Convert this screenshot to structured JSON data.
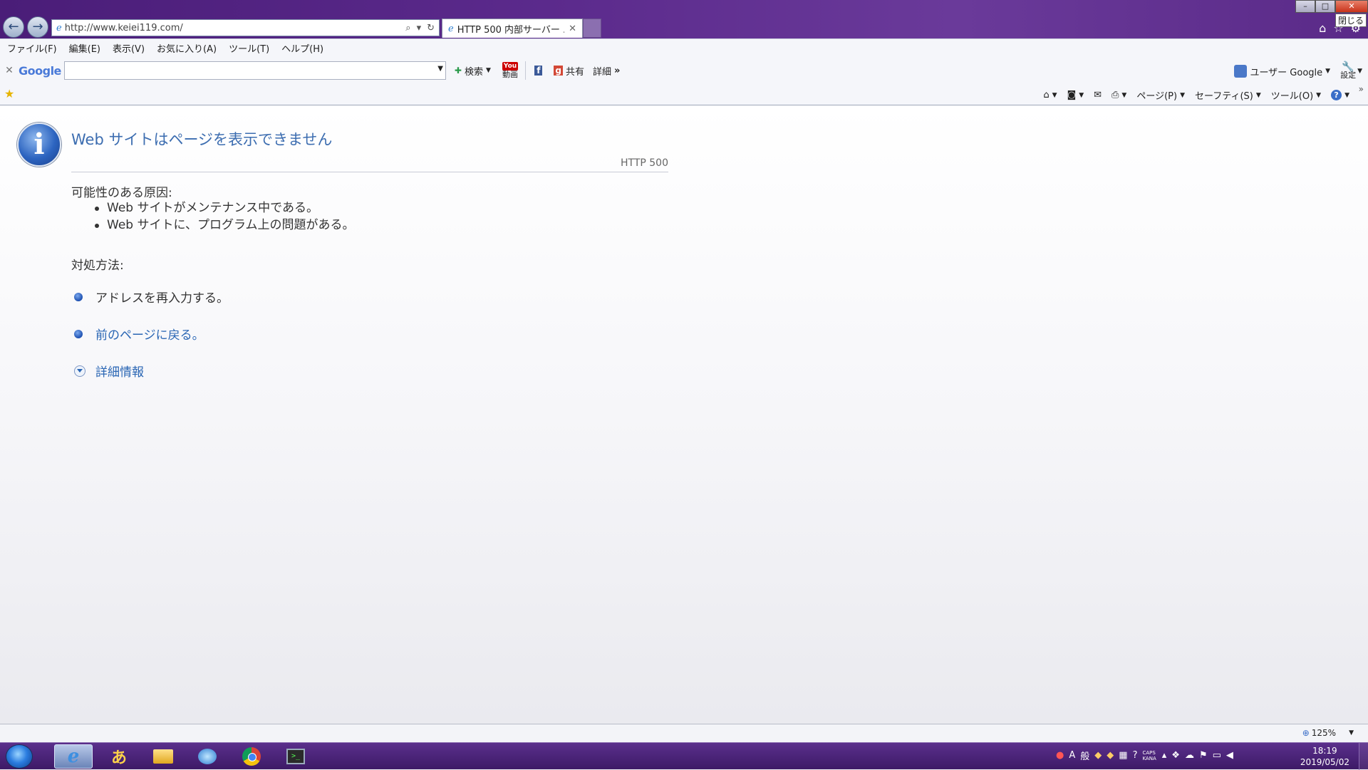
{
  "browser": {
    "address_url": "http://www.keiei119.com/",
    "tab_title": "HTTP 500 内部サーバー ...",
    "close_tooltip": "閉じる"
  },
  "menu": {
    "items": [
      "ファイル(F)",
      "編集(E)",
      "表示(V)",
      "お気に入り(A)",
      "ツール(T)",
      "ヘルプ(H)"
    ]
  },
  "google_toolbar": {
    "logo": "Google",
    "search_placeholder": "",
    "search_label": "検索",
    "youtube_logo": "You",
    "video_label": "動画",
    "share_label": "共有",
    "details_label": "詳細",
    "more": "»",
    "user_label": "ユーザー Google",
    "settings_label": "設定"
  },
  "command_bar": {
    "page_label": "ページ(P)",
    "safety_label": "セーフティ(S)",
    "tools_label": "ツール(O)"
  },
  "error_page": {
    "title": "Web サイトはページを表示できません",
    "code": "HTTP 500",
    "causes_heading": "可能性のある原因:",
    "causes": [
      "Web サイトがメンテナンス中である。",
      "Web サイトに、プログラム上の問題がある。"
    ],
    "fix_heading": "対処方法:",
    "fix_retype": "アドレスを再入力する。",
    "fix_back": "前のページに戻る。",
    "more_info": "詳細情報"
  },
  "status_bar": {
    "zoom": "125%"
  },
  "taskbar": {
    "time": "18:19",
    "date": "2019/05/02",
    "ime_a": "A",
    "ime_mode": "般",
    "caps": "CAPS",
    "kana": "KANA"
  },
  "colors": {
    "title_blue": "#3c6db0",
    "link_blue": "#2a66b4",
    "taskbar_purple": "#4a1d78"
  }
}
